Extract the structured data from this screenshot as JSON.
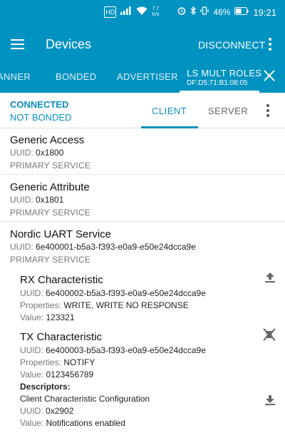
{
  "status_bar": {
    "hd_badge": "HD",
    "net_speed_value": "7.7",
    "net_speed_unit": "K/s",
    "battery": "46%",
    "time": "19:21"
  },
  "app_bar": {
    "title": "Devices",
    "disconnect_label": "DISCONNECT"
  },
  "device_tabs": [
    {
      "label": "ANNER"
    },
    {
      "label": "BONDED"
    },
    {
      "label": "ADVERTISER"
    },
    {
      "label": "LS MULT ROLES",
      "address": "DF:D5:71:B1:08:05"
    }
  ],
  "connection": {
    "state": "CONNECTED",
    "bond": "NOT BONDED",
    "tab_client": "CLIENT",
    "tab_server": "SERVER"
  },
  "labels": {
    "uuid": "UUID:",
    "properties": "Properties:",
    "value": "Value:",
    "descriptors": "Descriptors:"
  },
  "services": [
    {
      "name": "Generic Access",
      "uuid": "0x1800",
      "type": "PRIMARY SERVICE"
    },
    {
      "name": "Generic Attribute",
      "uuid": "0x1801",
      "type": "PRIMARY SERVICE"
    },
    {
      "name": "Nordic UART Service",
      "uuid": "6e400001-b5a3-f393-e0a9-e50e24dcca9e",
      "type": "PRIMARY SERVICE",
      "characteristics": [
        {
          "name": "RX Characteristic",
          "uuid": "6e400002-b5a3-f393-e0a9-e50e24dcca9e",
          "properties": "WRITE, WRITE NO RESPONSE",
          "value": "123321",
          "icon": "upload-icon"
        },
        {
          "name": "TX Characteristic",
          "uuid": "6e400003-b5a3-f393-e0a9-e50e24dcca9e",
          "properties": "NOTIFY",
          "value": "0123456789",
          "icon": "notifications-off-icon",
          "descriptor": {
            "name": "Client Characteristic Configuration",
            "uuid": "0x2902",
            "value": "Notifications enabled",
            "icon": "download-icon"
          }
        }
      ]
    }
  ],
  "colors": {
    "primary": "#0092c0",
    "accent": "#0a8fbf"
  }
}
